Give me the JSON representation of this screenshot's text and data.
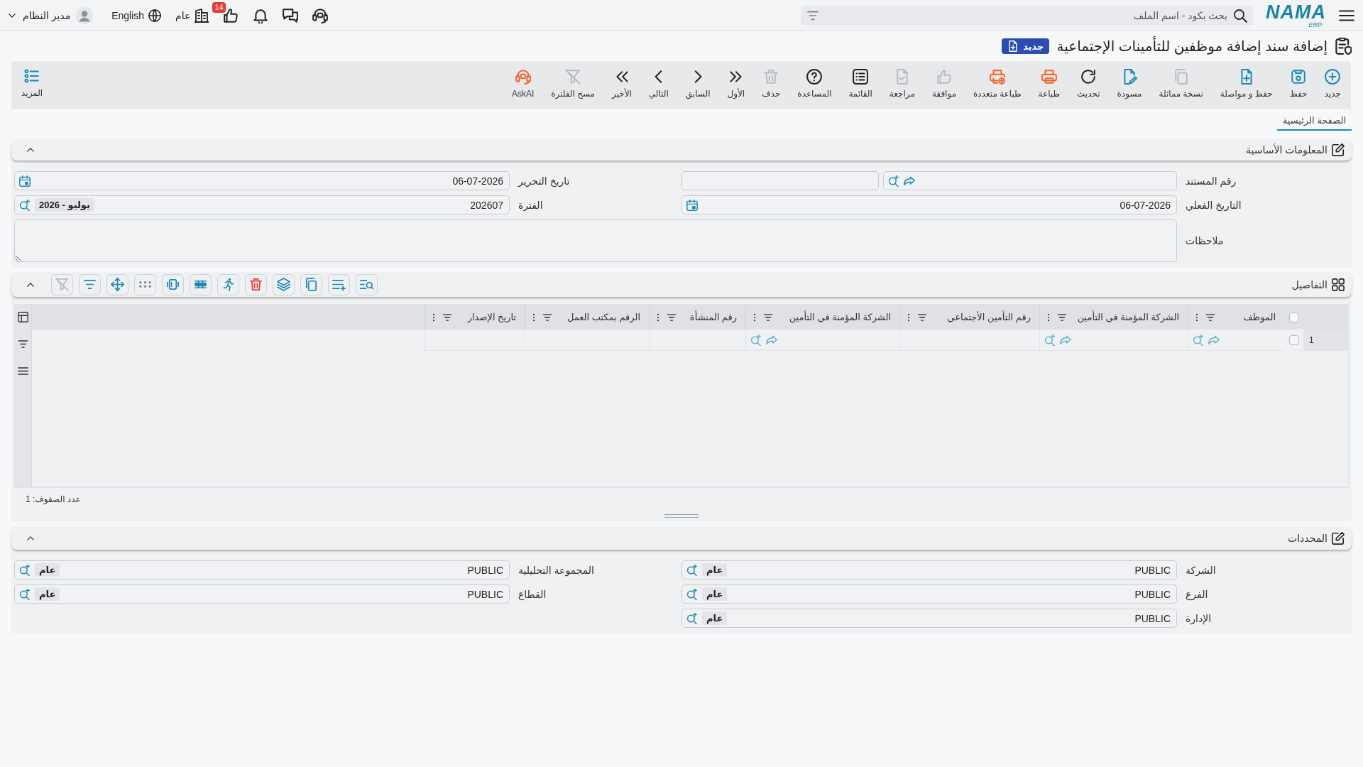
{
  "header": {
    "logo": "NAMA",
    "logo_sub": "ERP",
    "search": {
      "placeholder": "بحث بكود - اسم الملف"
    },
    "notification_count": "14",
    "branch": "عام",
    "language": "English",
    "user": "مدير النظام"
  },
  "page_title": "إضافة سند إضافة موظفين للتأمينات الإجتماعية",
  "status": "جديد",
  "toolbar": {
    "buttons": [
      {
        "kind": "new",
        "label": "جديد",
        "disabled": false
      },
      {
        "kind": "save",
        "label": "حفظ",
        "disabled": false
      },
      {
        "kind": "save_continue",
        "label": "حفظ و مواصلة",
        "disabled": false
      },
      {
        "kind": "duplicate",
        "label": "نسخة مماثلة",
        "disabled": true
      },
      {
        "kind": "draft",
        "label": "مسودة",
        "disabled": false
      },
      {
        "kind": "refresh",
        "label": "تحديث",
        "disabled": false
      },
      {
        "kind": "print",
        "label": "طباعة",
        "disabled": false
      },
      {
        "kind": "print_multi",
        "label": "طباعة متعددة",
        "disabled": false
      },
      {
        "kind": "approve",
        "label": "موافقة",
        "disabled": true
      },
      {
        "kind": "review",
        "label": "مراجعة",
        "disabled": true
      },
      {
        "kind": "list",
        "label": "القائمة",
        "disabled": false
      },
      {
        "kind": "help",
        "label": "المساعدة",
        "disabled": false
      },
      {
        "kind": "delete",
        "label": "حذف",
        "disabled": true
      },
      {
        "kind": "first",
        "label": "الأول",
        "disabled": false
      },
      {
        "kind": "previous",
        "label": "السابق",
        "disabled": false
      },
      {
        "kind": "next",
        "label": "التالي",
        "disabled": false
      },
      {
        "kind": "last",
        "label": "الأخير",
        "disabled": false
      },
      {
        "kind": "clear_filter",
        "label": "مسح الفلترة",
        "disabled": true
      },
      {
        "kind": "ask_ai",
        "label": "AskAI",
        "disabled": false
      }
    ],
    "more": "المزيد"
  },
  "tabs": [
    {
      "label": "الصفحة الرئيسية",
      "selected": true
    }
  ],
  "basic_info": {
    "title": "المعلومات الأساسية",
    "expanded": true,
    "fields": [
      {
        "kind": "doc_number",
        "label": "رقم المستند"
      },
      {
        "kind": "date",
        "label": "تاريخ التحرير",
        "value": "06-07-2026"
      },
      {
        "kind": "date",
        "label": "التاريخ الفعلي",
        "value": "06-07-2026"
      },
      {
        "kind": "lookup",
        "label": "الفترة",
        "value": "202607",
        "chip": "يوليو - 2026"
      },
      {
        "kind": "textarea",
        "label": "ملاحظات"
      }
    ]
  },
  "details": {
    "title": "التفاصيل",
    "expanded": true,
    "tools": [
      {
        "kind": "find",
        "disabled": false
      },
      {
        "kind": "add_rows",
        "disabled": false
      },
      {
        "kind": "copy",
        "disabled": false
      },
      {
        "kind": "layers",
        "disabled": false
      },
      {
        "kind": "delete",
        "disabled": false
      },
      {
        "kind": "run",
        "disabled": false
      },
      {
        "kind": "insert_row",
        "disabled": false
      },
      {
        "kind": "fit_columns",
        "disabled": false
      },
      {
        "kind": "dots",
        "disabled": false
      },
      {
        "kind": "move",
        "disabled": false
      },
      {
        "kind": "filter",
        "disabled": false
      },
      {
        "kind": "clear_filter",
        "disabled": true
      }
    ],
    "table": {
      "all_checked": false,
      "columns": [
        {
          "label": "الموظف",
          "kind": "lookup"
        },
        {
          "label": "الشركة المؤمنة في التأمين",
          "kind": "lookup"
        },
        {
          "label": "رقم التأمين الأجتماعي",
          "kind": "text"
        },
        {
          "label": "الشركة المؤمنة في التأمين",
          "kind": "lookup"
        },
        {
          "label": "رقم المنشأة",
          "kind": "text"
        },
        {
          "label": "الرقم بمكتب العمل",
          "kind": "text"
        },
        {
          "label": "تاريخ الإصدار",
          "kind": "text"
        }
      ],
      "rows": [
        {
          "number": "1",
          "checked": false
        }
      ]
    },
    "row_count": "عدد الصفوف: 1"
  },
  "dimensions": {
    "title": "المحددات",
    "expanded": true,
    "fields": [
      {
        "kind": "lookup",
        "label": "الشركة",
        "value": "PUBLIC",
        "chip": "عام"
      },
      {
        "kind": "lookup",
        "label": "المجموعة التحليلية",
        "value": "PUBLIC",
        "chip": "عام"
      },
      {
        "kind": "lookup",
        "label": "الفرع",
        "value": "PUBLIC",
        "chip": "عام"
      },
      {
        "kind": "lookup",
        "label": "القطاع",
        "value": "PUBLIC",
        "chip": "عام"
      },
      {
        "kind": "lookup",
        "label": "الإدارة",
        "value": "PUBLIC",
        "chip": "عام"
      }
    ]
  }
}
